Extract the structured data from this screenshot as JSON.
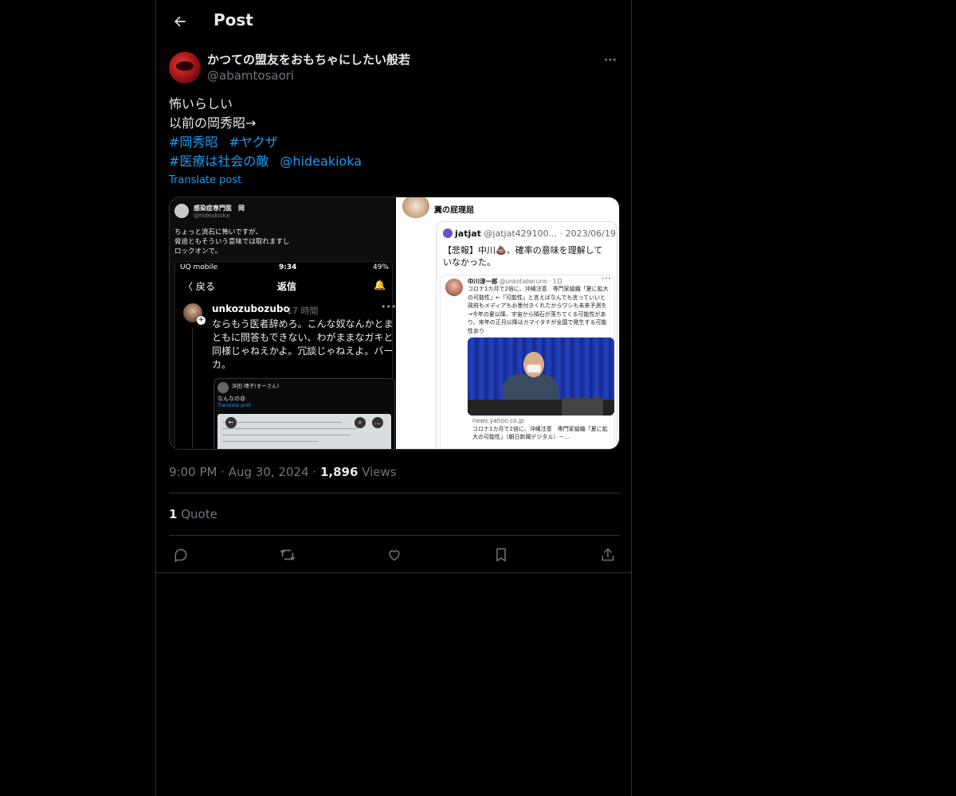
{
  "header": {
    "title": "Post"
  },
  "post": {
    "display_name": "かつての盟友をおもちゃにしたい般若",
    "handle": "@abamtosaori",
    "lines": [
      "怖いらしい",
      "以前の岡秀昭→"
    ],
    "hashtags_line1": [
      "#岡秀昭",
      "#ヤクザ"
    ],
    "hashtags_line2": [
      "#医療は社会の敵"
    ],
    "mention": "@hideakioka",
    "translate": "Translate post",
    "time": "9:00 PM",
    "date": "Aug 30, 2024",
    "views_count": "1,896",
    "views_label": "Views",
    "quote_count": "1",
    "quote_label": "Quote"
  },
  "media_left": {
    "name": "感染症専門医　岡",
    "handle": "@hideakioka",
    "text_lines": [
      "ちょっと流石に怖いですが、",
      "脅迫ともそういう意味では取れますし",
      "ロックオンで。"
    ],
    "status_carrier": "UQ mobile",
    "status_time": "9:34",
    "status_battery": "49%",
    "nav_back": "〈 戻る",
    "nav_title": "返信",
    "reply_name": "unkozubozubo",
    "reply_time": "17 時間",
    "reply_text": "ならもう医者辞めろ。こんな奴なんかとまともに問答もできない、わがままなガキと同様じゃねえかよ。冗談じゃねえよ。バーカ。",
    "quote_name": "浜田 晴子(すーさん)",
    "quote_text": "なんなの😩",
    "quote_translate": "Translate post"
  },
  "media_right": {
    "title": "糞の屁理屈",
    "user": "jatjat",
    "user_meta": "@jatjat429100... · 2023/06/19",
    "text": "【悲報】中川💩、確率の意味を理解していなかった。",
    "inner_name": "中川淳一郎",
    "inner_meta": "@unkotaberuno · 1日",
    "inner_text": "コロナ1カ月で2倍に、沖縄注意　専門家組織「夏に拡大の可能性」←「可能性」と言えばなんでも言っていいと政府もメディアもお墨付きくれたからワシも未来予測を→今年の夏以降、宇宙から隕石が落ちてくる可能性があり、来年の正月以降はカマイタチが全国で発生する可能性あり",
    "source": "news.yahoo.co.jp",
    "source_text": "コロナ1カ月で2倍に、沖縄注意　専門家組織「夏に拡大の可能性」（朝日新聞デジタル）－..."
  },
  "colors": {
    "link": "#1d9bf0",
    "muted": "#71767b",
    "border": "#2f3336"
  }
}
